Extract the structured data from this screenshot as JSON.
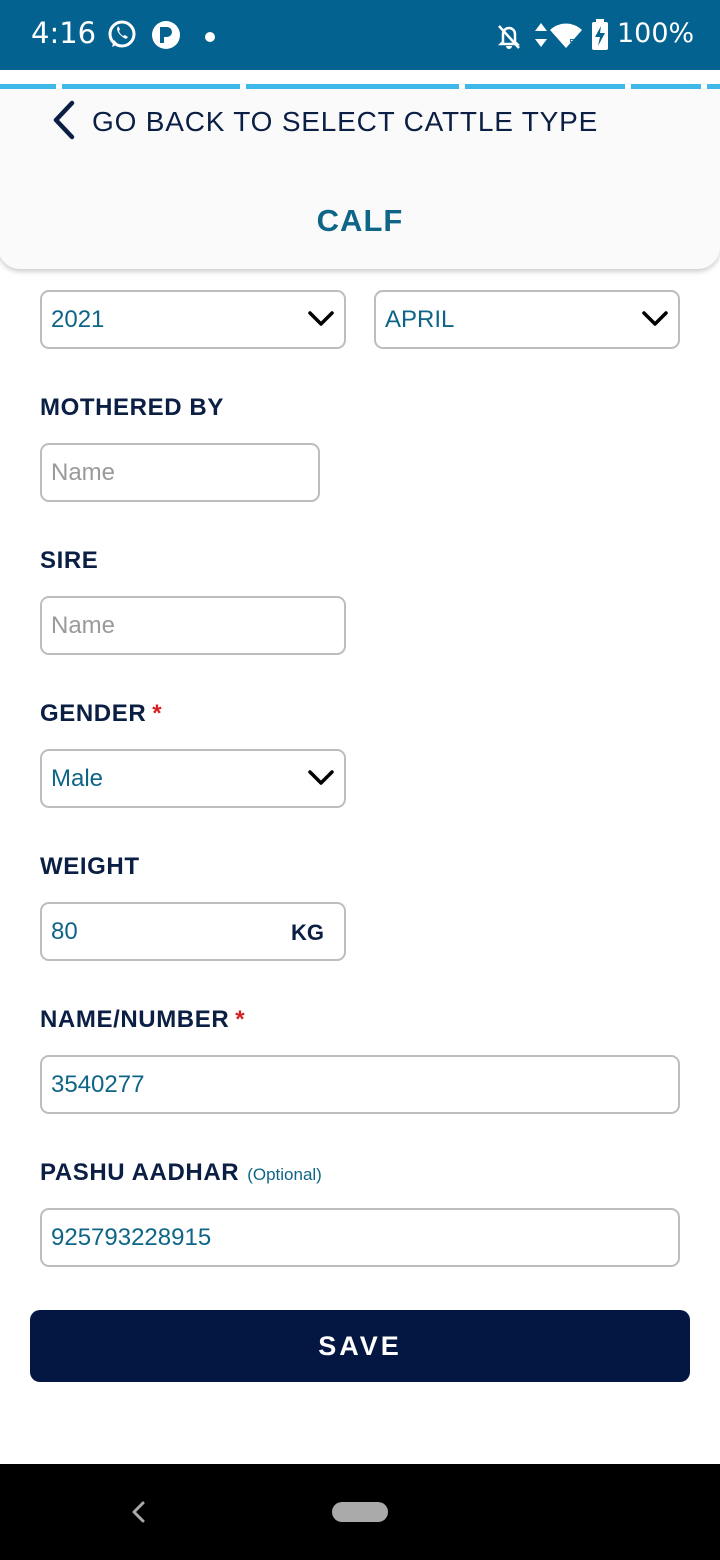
{
  "status_bar": {
    "time": "4:16",
    "battery": "100%",
    "icons": [
      "whatsapp-icon",
      "app-p-icon",
      "dot-icon",
      "bell-off-icon",
      "data-arrows-icon",
      "wifi-icon",
      "battery-charging-icon"
    ]
  },
  "header": {
    "back_label": "GO BACK TO SELECT CATTLE TYPE",
    "title": "CALF"
  },
  "form": {
    "year": {
      "value": "2021"
    },
    "month": {
      "value": "APRIL"
    },
    "mothered_by": {
      "label": "MOTHERED BY",
      "placeholder": "Name"
    },
    "sire": {
      "label": "SIRE",
      "placeholder": "Name"
    },
    "gender": {
      "label": "GENDER",
      "required": "*",
      "value": "Male"
    },
    "weight": {
      "label": "WEIGHT",
      "value": "80",
      "unit": "KG"
    },
    "name_number": {
      "label": "NAME/NUMBER",
      "required": "*",
      "value": "3540277"
    },
    "pashu_aadhar": {
      "label": "PASHU AADHAR",
      "optional": "(Optional)",
      "value": "925793228915"
    }
  },
  "actions": {
    "save_label": "SAVE"
  },
  "colors": {
    "status_bar": "#03628f",
    "accent_teal": "#0f6587",
    "navy": "#0b1f45",
    "save_button": "#041742",
    "progress": "#3fb8ea",
    "required": "#d72020"
  }
}
